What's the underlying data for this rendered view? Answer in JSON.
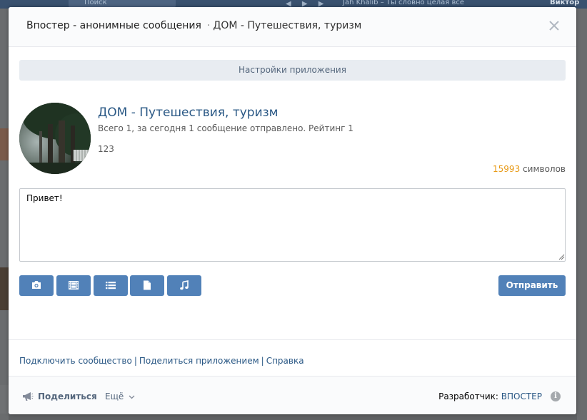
{
  "background": {
    "search_placeholder": "Поиск",
    "now_playing": "Jah Khalib – Ты словно целая все",
    "user_name": "Виктор"
  },
  "modal": {
    "app_name": "Впостер - анонимные сообщения",
    "separator": "·",
    "subtitle": "ДОМ - Путешествия, туризм",
    "close_icon": "close-icon"
  },
  "settings": {
    "label": "Настройки приложения"
  },
  "community": {
    "name": "ДОМ - Путешествия, туризм",
    "stats": "Всего 1, за сегодня 1 сообщение отправлено. Рейтинг 1",
    "description": "123",
    "chars_count": "15993",
    "chars_label": "символов"
  },
  "composer": {
    "message_value": "Привет!",
    "attachments": [
      {
        "icon": "camera-icon",
        "name": "photo"
      },
      {
        "icon": "film-icon",
        "name": "video"
      },
      {
        "icon": "list-icon",
        "name": "poll"
      },
      {
        "icon": "document-icon",
        "name": "document"
      },
      {
        "icon": "music-note-icon",
        "name": "audio"
      }
    ],
    "send_label": "Отправить"
  },
  "links": {
    "connect": "Подключить сообщество",
    "share_app": "Поделиться приложением",
    "help": "Справка",
    "separator": "|"
  },
  "footer": {
    "share_label": "Поделиться",
    "more_label": "Ещё",
    "developer_label": "Разработчик:",
    "developer_name": "ВПОСТЕР"
  },
  "colors": {
    "accent_button": "#5181b8",
    "link": "#2a5885",
    "counter": "#e89a16"
  }
}
